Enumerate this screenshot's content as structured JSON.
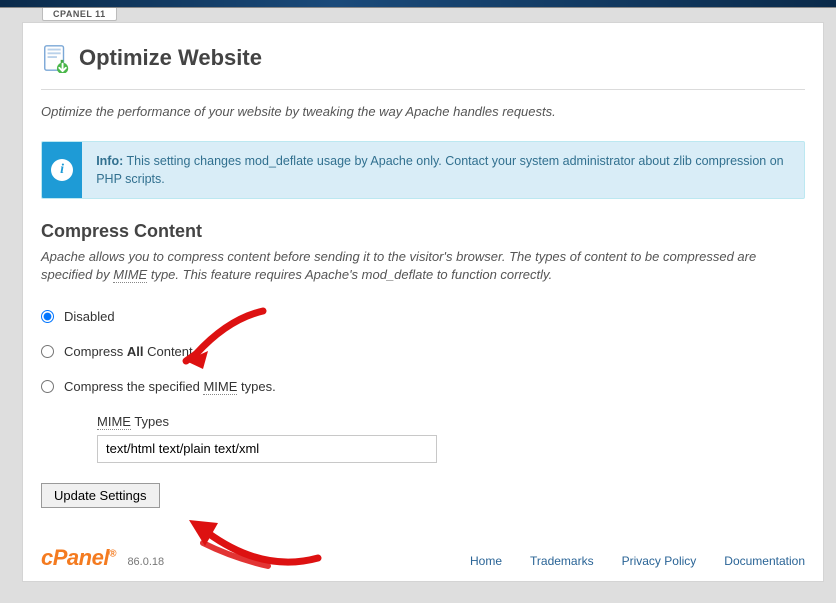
{
  "tab_label": "CPANEL 11",
  "page": {
    "title": "Optimize Website",
    "intro": "Optimize the performance of your website by tweaking the way Apache handles requests."
  },
  "info": {
    "prefix": "Info:",
    "text": " This setting changes mod_deflate usage by Apache only. Contact your system administrator about zlib compression on PHP scripts."
  },
  "compress": {
    "heading": "Compress Content",
    "desc_1": "Apache allows you to compress content before sending it to the visitor's browser. The types of content to be compressed are specified by ",
    "mime_abbr": "MIME",
    "desc_2": " type. This feature requires Apache's mod_deflate to function correctly."
  },
  "options": {
    "disabled": "Disabled",
    "all_pre": "Compress ",
    "all_bold": "All",
    "all_post": " Content",
    "spec_pre": "Compress the specified ",
    "spec_mime": "MIME",
    "spec_post": " types."
  },
  "mime": {
    "label_pre": "MIME",
    "label_post": " Types",
    "value": "text/html text/plain text/xml"
  },
  "buttons": {
    "update": "Update Settings"
  },
  "footer": {
    "brand": "cPanel",
    "version": "86.0.18",
    "links": {
      "home": "Home",
      "trademarks": "Trademarks",
      "privacy": "Privacy Policy",
      "docs": "Documentation"
    }
  }
}
